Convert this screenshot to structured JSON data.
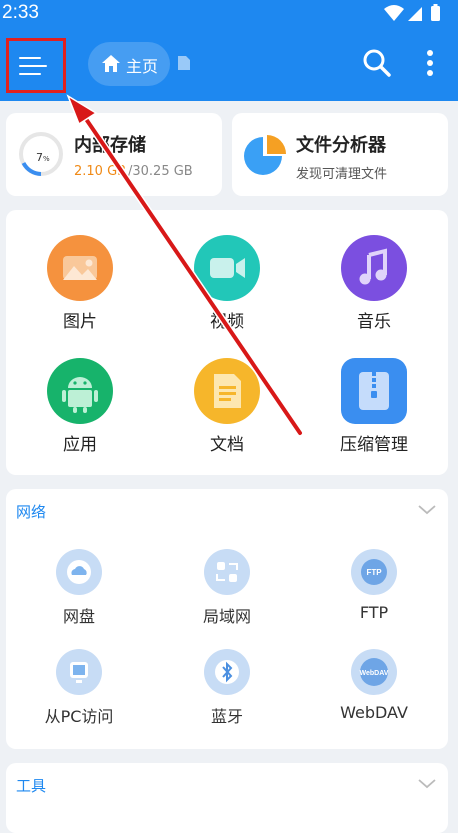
{
  "status_bar": {
    "time": "2:33"
  },
  "toolbar": {
    "home_label": "主页"
  },
  "storage": {
    "title": "内部存储",
    "percent": "7",
    "percent_unit": "%",
    "used": "2.10 GB",
    "total": "/30.25 GB"
  },
  "analyzer": {
    "title": "文件分析器",
    "subtitle": "发现可清理文件"
  },
  "categories": [
    {
      "label": "图片",
      "color": "#f5923e"
    },
    {
      "label": "视频",
      "color": "#22c7b8"
    },
    {
      "label": "音乐",
      "color": "#7b4fe0"
    },
    {
      "label": "应用",
      "color": "#17b36b"
    },
    {
      "label": "文档",
      "color": "#f6b62b"
    },
    {
      "label": "压缩管理",
      "color": "#3a8ef0"
    }
  ],
  "network": {
    "title": "网络",
    "items": [
      {
        "label": "网盘",
        "icon": "cloud-icon"
      },
      {
        "label": "局域网",
        "icon": "lan-icon"
      },
      {
        "label": "FTP",
        "icon": "ftp-icon",
        "badge": "FTP"
      },
      {
        "label": "从PC访问",
        "icon": "pc-icon"
      },
      {
        "label": "蓝牙",
        "icon": "bluetooth-icon"
      },
      {
        "label": "WebDAV",
        "icon": "webdav-icon",
        "badge": "WebDAV"
      }
    ]
  },
  "tools": {
    "title": "工具"
  },
  "colors": {
    "primary": "#1e88f0",
    "highlight": "#e02020",
    "storage_used": "#f08a17"
  }
}
